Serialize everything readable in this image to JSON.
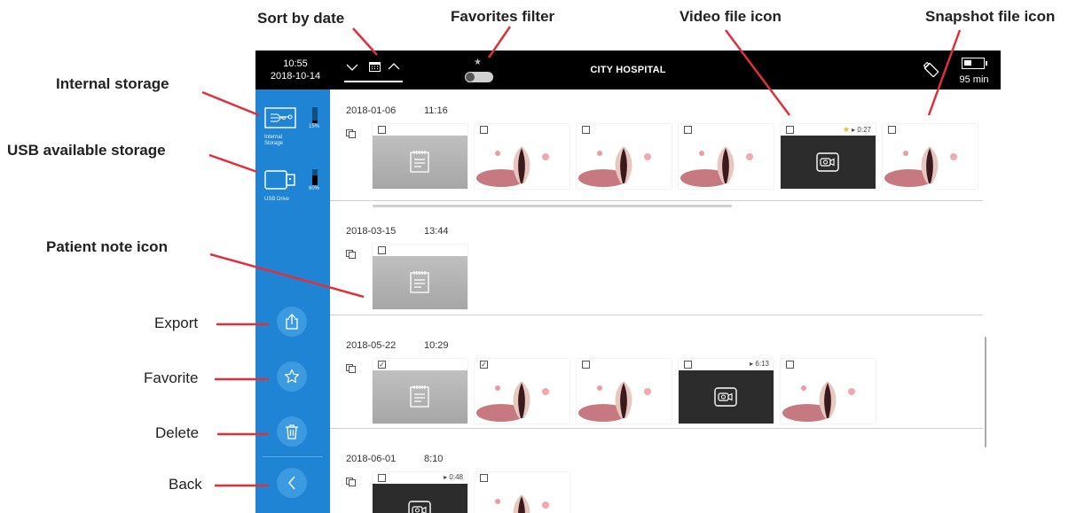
{
  "callouts": {
    "sort_by_date": "Sort by date",
    "favorites_filter": "Favorites filter",
    "video_file_icon": "Video file icon",
    "snapshot_file_icon": "Snapshot file icon",
    "internal_storage": "Internal storage",
    "usb_available_storage": "USB available storage",
    "patient_note_icon": "Patient note icon",
    "export": "Export",
    "favorite": "Favorite",
    "delete": "Delete",
    "back": "Back"
  },
  "topbar": {
    "time": "10:55",
    "date": "2018-10-14",
    "title": "CITY HOSPITAL",
    "battery_time": "95 min",
    "battery_level": 0.4,
    "favorites_filter_on": false
  },
  "sidebar": {
    "internal_storage": {
      "label": "Internal Storage",
      "percent": "15%",
      "used_fraction": 0.15
    },
    "usb_drive": {
      "label": "USB Drive",
      "percent": "60%",
      "used_fraction": 0.6
    }
  },
  "sessions": [
    {
      "date": "2018-01-06",
      "time": "11:16",
      "items": [
        {
          "type": "note",
          "checked": false,
          "favorite": false,
          "duration": ""
        },
        {
          "type": "snapshot",
          "checked": false,
          "favorite": false,
          "duration": ""
        },
        {
          "type": "snapshot",
          "checked": false,
          "favorite": false,
          "duration": ""
        },
        {
          "type": "snapshot",
          "checked": false,
          "favorite": false,
          "duration": ""
        },
        {
          "type": "video",
          "checked": false,
          "favorite": true,
          "duration": "0:27"
        },
        {
          "type": "snapshot",
          "checked": false,
          "favorite": false,
          "duration": ""
        }
      ]
    },
    {
      "date": "2018-03-15",
      "time": "13:44",
      "items": [
        {
          "type": "note",
          "checked": false,
          "favorite": false,
          "duration": ""
        }
      ]
    },
    {
      "date": "2018-05-22",
      "time": "10:29",
      "items": [
        {
          "type": "note",
          "checked": true,
          "favorite": false,
          "duration": ""
        },
        {
          "type": "snapshot",
          "checked": true,
          "favorite": false,
          "duration": ""
        },
        {
          "type": "snapshot",
          "checked": false,
          "favorite": false,
          "duration": ""
        },
        {
          "type": "video",
          "checked": false,
          "favorite": false,
          "duration": "6:13"
        },
        {
          "type": "snapshot",
          "checked": false,
          "favorite": false,
          "duration": ""
        }
      ]
    },
    {
      "date": "2018-06-01",
      "time": "8:10",
      "items": [
        {
          "type": "video",
          "checked": false,
          "favorite": false,
          "duration": "0:48"
        },
        {
          "type": "snapshot",
          "checked": false,
          "favorite": false,
          "duration": ""
        }
      ]
    }
  ],
  "colors": {
    "sidebar": "#1f84d3",
    "topbar": "#000000",
    "callout_line": "#e0303a",
    "favorite_star": "#f0b81b"
  },
  "icons": [
    "sort-down-icon",
    "calendar-icon",
    "sort-up-icon",
    "star-icon",
    "usb-icon",
    "battery-icon",
    "export-icon",
    "favorite-star-icon",
    "trash-icon",
    "back-chevron-icon",
    "note-icon",
    "video-camera-icon",
    "stack-icon"
  ]
}
